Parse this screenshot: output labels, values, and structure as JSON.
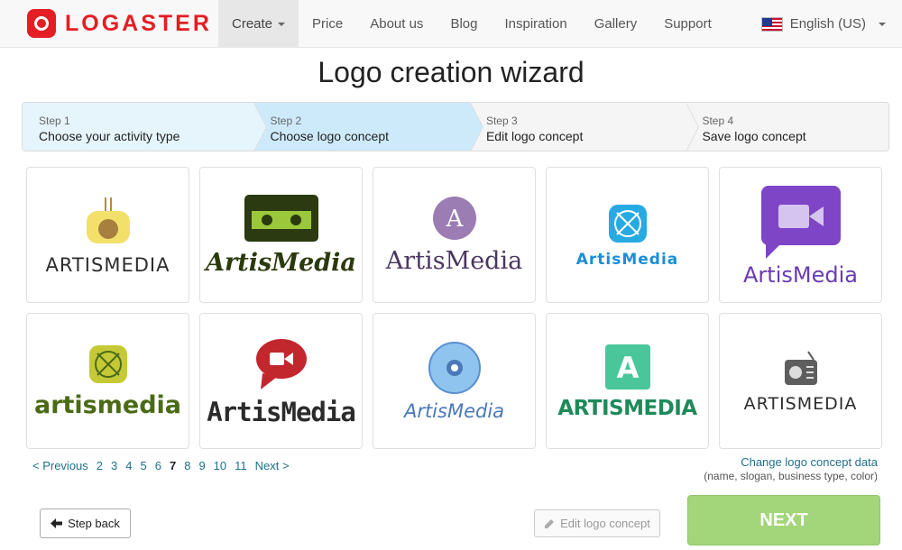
{
  "brand": {
    "name": "LOGASTER",
    "color": "#e31e24"
  },
  "nav": {
    "items": [
      {
        "label": "Create",
        "active": true,
        "dropdown": true
      },
      {
        "label": "Price"
      },
      {
        "label": "About us"
      },
      {
        "label": "Blog"
      },
      {
        "label": "Inspiration"
      },
      {
        "label": "Gallery"
      },
      {
        "label": "Support"
      }
    ],
    "language": "English (US)"
  },
  "page_title": "Logo creation wizard",
  "steps": [
    {
      "num": "Step 1",
      "title": "Choose your activity type"
    },
    {
      "num": "Step 2",
      "title": "Choose logo concept"
    },
    {
      "num": "Step 3",
      "title": "Edit logo concept"
    },
    {
      "num": "Step 4",
      "title": "Save logo concept"
    }
  ],
  "logos": [
    {
      "text": "ARTISMEDIA",
      "icon": "radio-yellow-icon",
      "color": "#2d2d2d"
    },
    {
      "text": "ArtisMedia",
      "icon": "cassette-icon",
      "color": "#2a3a0c"
    },
    {
      "text": "ArtisMedia",
      "icon": "letter-a-circle-icon",
      "color": "#4a3560"
    },
    {
      "text": "ArtisMedia",
      "icon": "speaker-grid-icon",
      "color": "#1a8fd6"
    },
    {
      "text": "ArtisMedia",
      "icon": "video-chat-bubble-icon",
      "color": "#6a3bb3"
    },
    {
      "text": "artismedia",
      "icon": "speaker-olive-icon",
      "color": "#4a6b15"
    },
    {
      "text": "ArtisMedia",
      "icon": "video-bubble-red-icon",
      "color": "#2b2b2b"
    },
    {
      "text": "ArtisMedia",
      "icon": "cd-disc-icon",
      "color": "#4a78b8"
    },
    {
      "text": "ARTISMEDIA",
      "icon": "letter-a-square-icon",
      "color": "#1e8a5a"
    },
    {
      "text": "ARTISMEDIA",
      "icon": "radio-gray-icon",
      "color": "#2d2d2d"
    }
  ],
  "pager": {
    "prev": "< Previous",
    "pages": [
      "2",
      "3",
      "4",
      "5",
      "6",
      "7",
      "8",
      "9",
      "10",
      "11"
    ],
    "current": "7",
    "next": "Next >"
  },
  "change_concept": {
    "link": "Change logo concept data",
    "sub": "(name, slogan, business type, color)"
  },
  "buttons": {
    "back": "Step back",
    "edit": "Edit logo concept",
    "next": "NEXT"
  }
}
